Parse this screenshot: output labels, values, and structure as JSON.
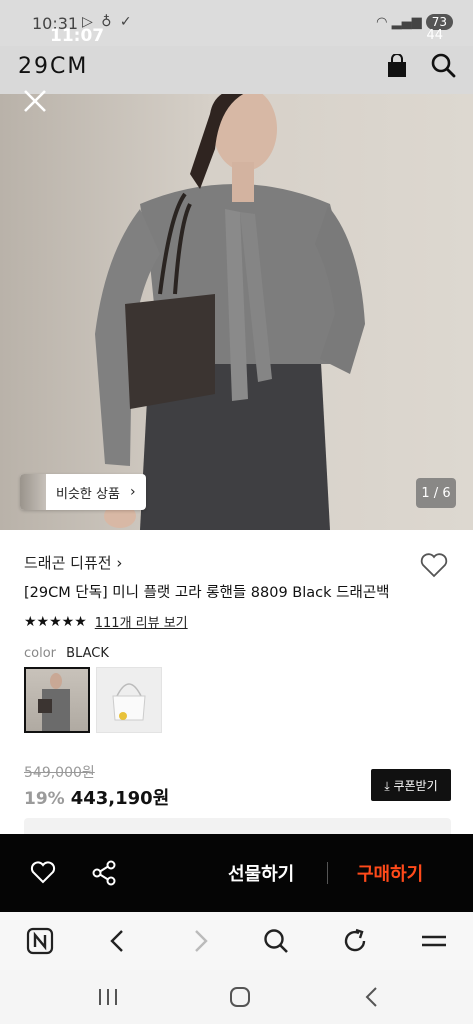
{
  "status_bar": {
    "time_back": "10:31",
    "time_front": "11:07",
    "battery": "73",
    "battery_front": "44"
  },
  "header": {
    "logo": "29CM"
  },
  "hero": {
    "similar_label": "비슷한 상품",
    "image_counter": "1 / 6"
  },
  "product": {
    "brand": "드래곤 디퓨전 ›",
    "title": "[29CM 단독] 미니 플랫 고라 롱핸들 8809 Black 드래곤백",
    "rating": 4.5,
    "stars_glyph": "★★★★★",
    "review_link": "111개 리뷰 보기",
    "color_label": "color",
    "color_value": "BLACK",
    "original_price": "549,000원",
    "discount": "19%",
    "sale_price": "443,190원",
    "coupon_label": "⤓ 쿠폰받기"
  },
  "action_bar": {
    "gift_label": "선물하기",
    "buy_label": "구매하기"
  },
  "colors": {
    "buy_accent": "#ff4a1a",
    "action_bar_bg": "#050505"
  }
}
